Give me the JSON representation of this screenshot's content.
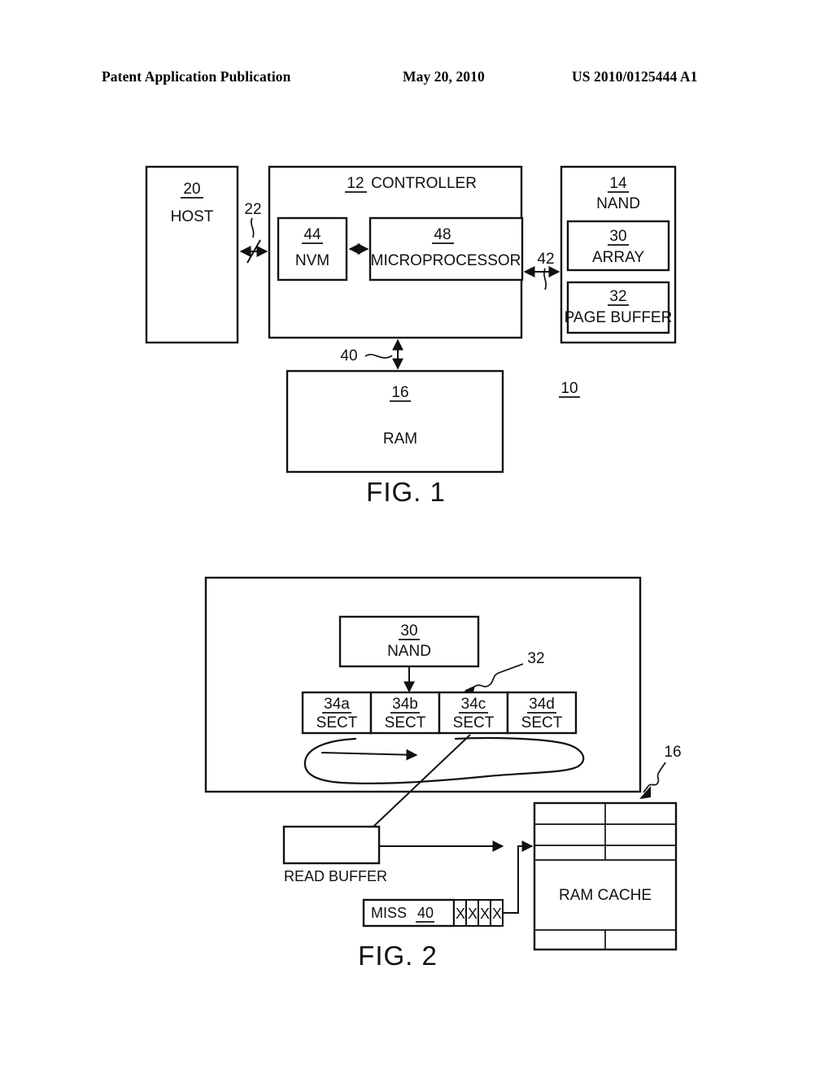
{
  "header": {
    "publication": "Patent Application Publication",
    "date": "May 20, 2010",
    "number": "US 2010/0125444 A1"
  },
  "figure1": {
    "caption": "FIG. 1",
    "system_ref": "10",
    "blocks": {
      "host": {
        "ref": "20",
        "label": "HOST"
      },
      "controller": {
        "ref": "12",
        "label": "CONTROLLER"
      },
      "nvm": {
        "ref": "44",
        "label": "NVM"
      },
      "microprocessor": {
        "ref": "48",
        "label": "MICROPROCESSOR"
      },
      "nand": {
        "ref": "14",
        "label": "NAND"
      },
      "array": {
        "ref": "30",
        "label": "ARRAY"
      },
      "page_buffer": {
        "ref": "32",
        "label": "PAGE BUFFER"
      },
      "ram": {
        "ref": "16",
        "label": "RAM"
      }
    },
    "connectors": {
      "host_to_controller": "22",
      "controller_to_nand": "42",
      "controller_to_ram": "40"
    }
  },
  "figure2": {
    "caption": "FIG. 2",
    "nand": {
      "ref": "30",
      "label": "NAND"
    },
    "page_buffer_ref": "32",
    "ram_ref": "16",
    "sectors": [
      {
        "ref": "34a",
        "label": "SECT"
      },
      {
        "ref": "34b",
        "label": "SECT"
      },
      {
        "ref": "34c",
        "label": "SECT"
      },
      {
        "ref": "34d",
        "label": "SECT"
      }
    ],
    "read_buffer": {
      "label": "READ BUFFER"
    },
    "miss_bar": {
      "label": "MISS",
      "ref": "40",
      "cells": [
        "X",
        "X",
        "X",
        "X"
      ]
    },
    "ram_cache": {
      "label": "RAM CACHE"
    }
  },
  "colors": {
    "ink": "#111111",
    "paper": "#ffffff"
  }
}
